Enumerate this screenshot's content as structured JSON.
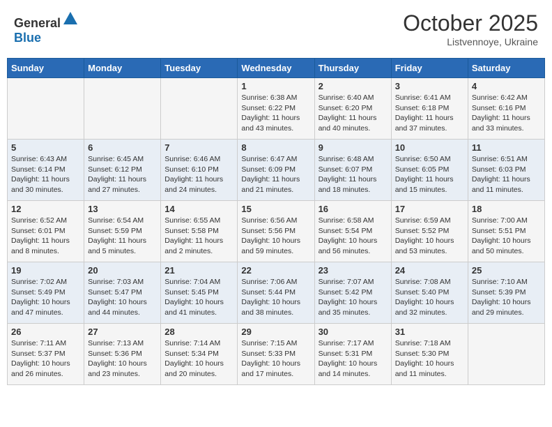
{
  "header": {
    "logo_general": "General",
    "logo_blue": "Blue",
    "month": "October 2025",
    "location": "Listvennoye, Ukraine"
  },
  "days_of_week": [
    "Sunday",
    "Monday",
    "Tuesday",
    "Wednesday",
    "Thursday",
    "Friday",
    "Saturday"
  ],
  "weeks": [
    [
      {
        "day": "",
        "info": ""
      },
      {
        "day": "",
        "info": ""
      },
      {
        "day": "",
        "info": ""
      },
      {
        "day": "1",
        "info": "Sunrise: 6:38 AM\nSunset: 6:22 PM\nDaylight: 11 hours\nand 43 minutes."
      },
      {
        "day": "2",
        "info": "Sunrise: 6:40 AM\nSunset: 6:20 PM\nDaylight: 11 hours\nand 40 minutes."
      },
      {
        "day": "3",
        "info": "Sunrise: 6:41 AM\nSunset: 6:18 PM\nDaylight: 11 hours\nand 37 minutes."
      },
      {
        "day": "4",
        "info": "Sunrise: 6:42 AM\nSunset: 6:16 PM\nDaylight: 11 hours\nand 33 minutes."
      }
    ],
    [
      {
        "day": "5",
        "info": "Sunrise: 6:43 AM\nSunset: 6:14 PM\nDaylight: 11 hours\nand 30 minutes."
      },
      {
        "day": "6",
        "info": "Sunrise: 6:45 AM\nSunset: 6:12 PM\nDaylight: 11 hours\nand 27 minutes."
      },
      {
        "day": "7",
        "info": "Sunrise: 6:46 AM\nSunset: 6:10 PM\nDaylight: 11 hours\nand 24 minutes."
      },
      {
        "day": "8",
        "info": "Sunrise: 6:47 AM\nSunset: 6:09 PM\nDaylight: 11 hours\nand 21 minutes."
      },
      {
        "day": "9",
        "info": "Sunrise: 6:48 AM\nSunset: 6:07 PM\nDaylight: 11 hours\nand 18 minutes."
      },
      {
        "day": "10",
        "info": "Sunrise: 6:50 AM\nSunset: 6:05 PM\nDaylight: 11 hours\nand 15 minutes."
      },
      {
        "day": "11",
        "info": "Sunrise: 6:51 AM\nSunset: 6:03 PM\nDaylight: 11 hours\nand 11 minutes."
      }
    ],
    [
      {
        "day": "12",
        "info": "Sunrise: 6:52 AM\nSunset: 6:01 PM\nDaylight: 11 hours\nand 8 minutes."
      },
      {
        "day": "13",
        "info": "Sunrise: 6:54 AM\nSunset: 5:59 PM\nDaylight: 11 hours\nand 5 minutes."
      },
      {
        "day": "14",
        "info": "Sunrise: 6:55 AM\nSunset: 5:58 PM\nDaylight: 11 hours\nand 2 minutes."
      },
      {
        "day": "15",
        "info": "Sunrise: 6:56 AM\nSunset: 5:56 PM\nDaylight: 10 hours\nand 59 minutes."
      },
      {
        "day": "16",
        "info": "Sunrise: 6:58 AM\nSunset: 5:54 PM\nDaylight: 10 hours\nand 56 minutes."
      },
      {
        "day": "17",
        "info": "Sunrise: 6:59 AM\nSunset: 5:52 PM\nDaylight: 10 hours\nand 53 minutes."
      },
      {
        "day": "18",
        "info": "Sunrise: 7:00 AM\nSunset: 5:51 PM\nDaylight: 10 hours\nand 50 minutes."
      }
    ],
    [
      {
        "day": "19",
        "info": "Sunrise: 7:02 AM\nSunset: 5:49 PM\nDaylight: 10 hours\nand 47 minutes."
      },
      {
        "day": "20",
        "info": "Sunrise: 7:03 AM\nSunset: 5:47 PM\nDaylight: 10 hours\nand 44 minutes."
      },
      {
        "day": "21",
        "info": "Sunrise: 7:04 AM\nSunset: 5:45 PM\nDaylight: 10 hours\nand 41 minutes."
      },
      {
        "day": "22",
        "info": "Sunrise: 7:06 AM\nSunset: 5:44 PM\nDaylight: 10 hours\nand 38 minutes."
      },
      {
        "day": "23",
        "info": "Sunrise: 7:07 AM\nSunset: 5:42 PM\nDaylight: 10 hours\nand 35 minutes."
      },
      {
        "day": "24",
        "info": "Sunrise: 7:08 AM\nSunset: 5:40 PM\nDaylight: 10 hours\nand 32 minutes."
      },
      {
        "day": "25",
        "info": "Sunrise: 7:10 AM\nSunset: 5:39 PM\nDaylight: 10 hours\nand 29 minutes."
      }
    ],
    [
      {
        "day": "26",
        "info": "Sunrise: 7:11 AM\nSunset: 5:37 PM\nDaylight: 10 hours\nand 26 minutes."
      },
      {
        "day": "27",
        "info": "Sunrise: 7:13 AM\nSunset: 5:36 PM\nDaylight: 10 hours\nand 23 minutes."
      },
      {
        "day": "28",
        "info": "Sunrise: 7:14 AM\nSunset: 5:34 PM\nDaylight: 10 hours\nand 20 minutes."
      },
      {
        "day": "29",
        "info": "Sunrise: 7:15 AM\nSunset: 5:33 PM\nDaylight: 10 hours\nand 17 minutes."
      },
      {
        "day": "30",
        "info": "Sunrise: 7:17 AM\nSunset: 5:31 PM\nDaylight: 10 hours\nand 14 minutes."
      },
      {
        "day": "31",
        "info": "Sunrise: 7:18 AM\nSunset: 5:30 PM\nDaylight: 10 hours\nand 11 minutes."
      },
      {
        "day": "",
        "info": ""
      }
    ]
  ]
}
